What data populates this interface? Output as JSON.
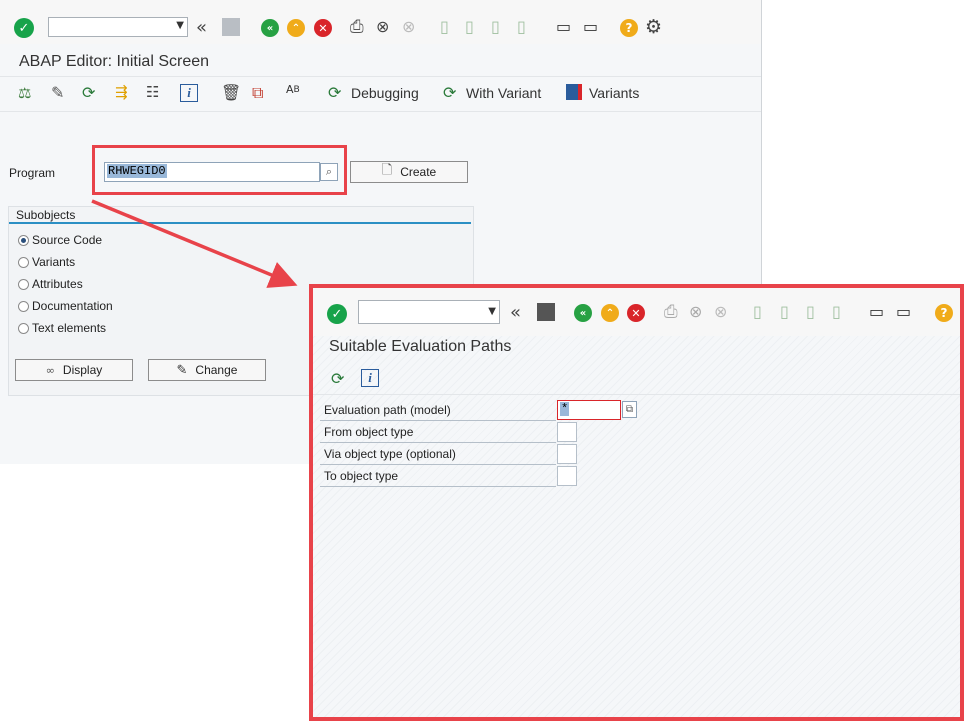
{
  "main_window": {
    "title": "ABAP Editor: Initial Screen",
    "toolbar": {
      "debugging_label": "Debugging",
      "with_variant_label": "With Variant",
      "variants_label": "Variants"
    },
    "program_label": "Program",
    "program_value": "RHWEGID0",
    "create_label": "Create",
    "subobjects": {
      "title": "Subobjects",
      "options": [
        {
          "label": "Source Code",
          "selected": true
        },
        {
          "label": "Variants",
          "selected": false
        },
        {
          "label": "Attributes",
          "selected": false
        },
        {
          "label": "Documentation",
          "selected": false
        },
        {
          "label": "Text elements",
          "selected": false
        }
      ]
    },
    "display_label": "Display",
    "change_label": "Change"
  },
  "popup_window": {
    "title": "Suitable Evaluation Paths",
    "fields": [
      {
        "label": "Evaluation path (model)",
        "value": "*"
      },
      {
        "label": "From object type",
        "value": ""
      },
      {
        "label": "Via object type (optional)",
        "value": ""
      },
      {
        "label": "To object type",
        "value": ""
      }
    ]
  },
  "accent_colors": {
    "highlight_red": "#e8434a",
    "ok_green": "#17a34a",
    "cancel_red": "#d9252a",
    "up_yellow": "#f0ab1a",
    "group_blue": "#2b8fc4"
  },
  "icons": [
    "ok-icon",
    "back-double-icon",
    "save-icon",
    "back-icon",
    "exit-icon",
    "cancel-icon",
    "print-icon",
    "find-icon",
    "find-next-icon",
    "first-page-icon",
    "previous-page-icon",
    "next-page-icon",
    "last-page-icon",
    "new-session-icon",
    "shortcut-icon",
    "help-icon",
    "settings-icon"
  ]
}
